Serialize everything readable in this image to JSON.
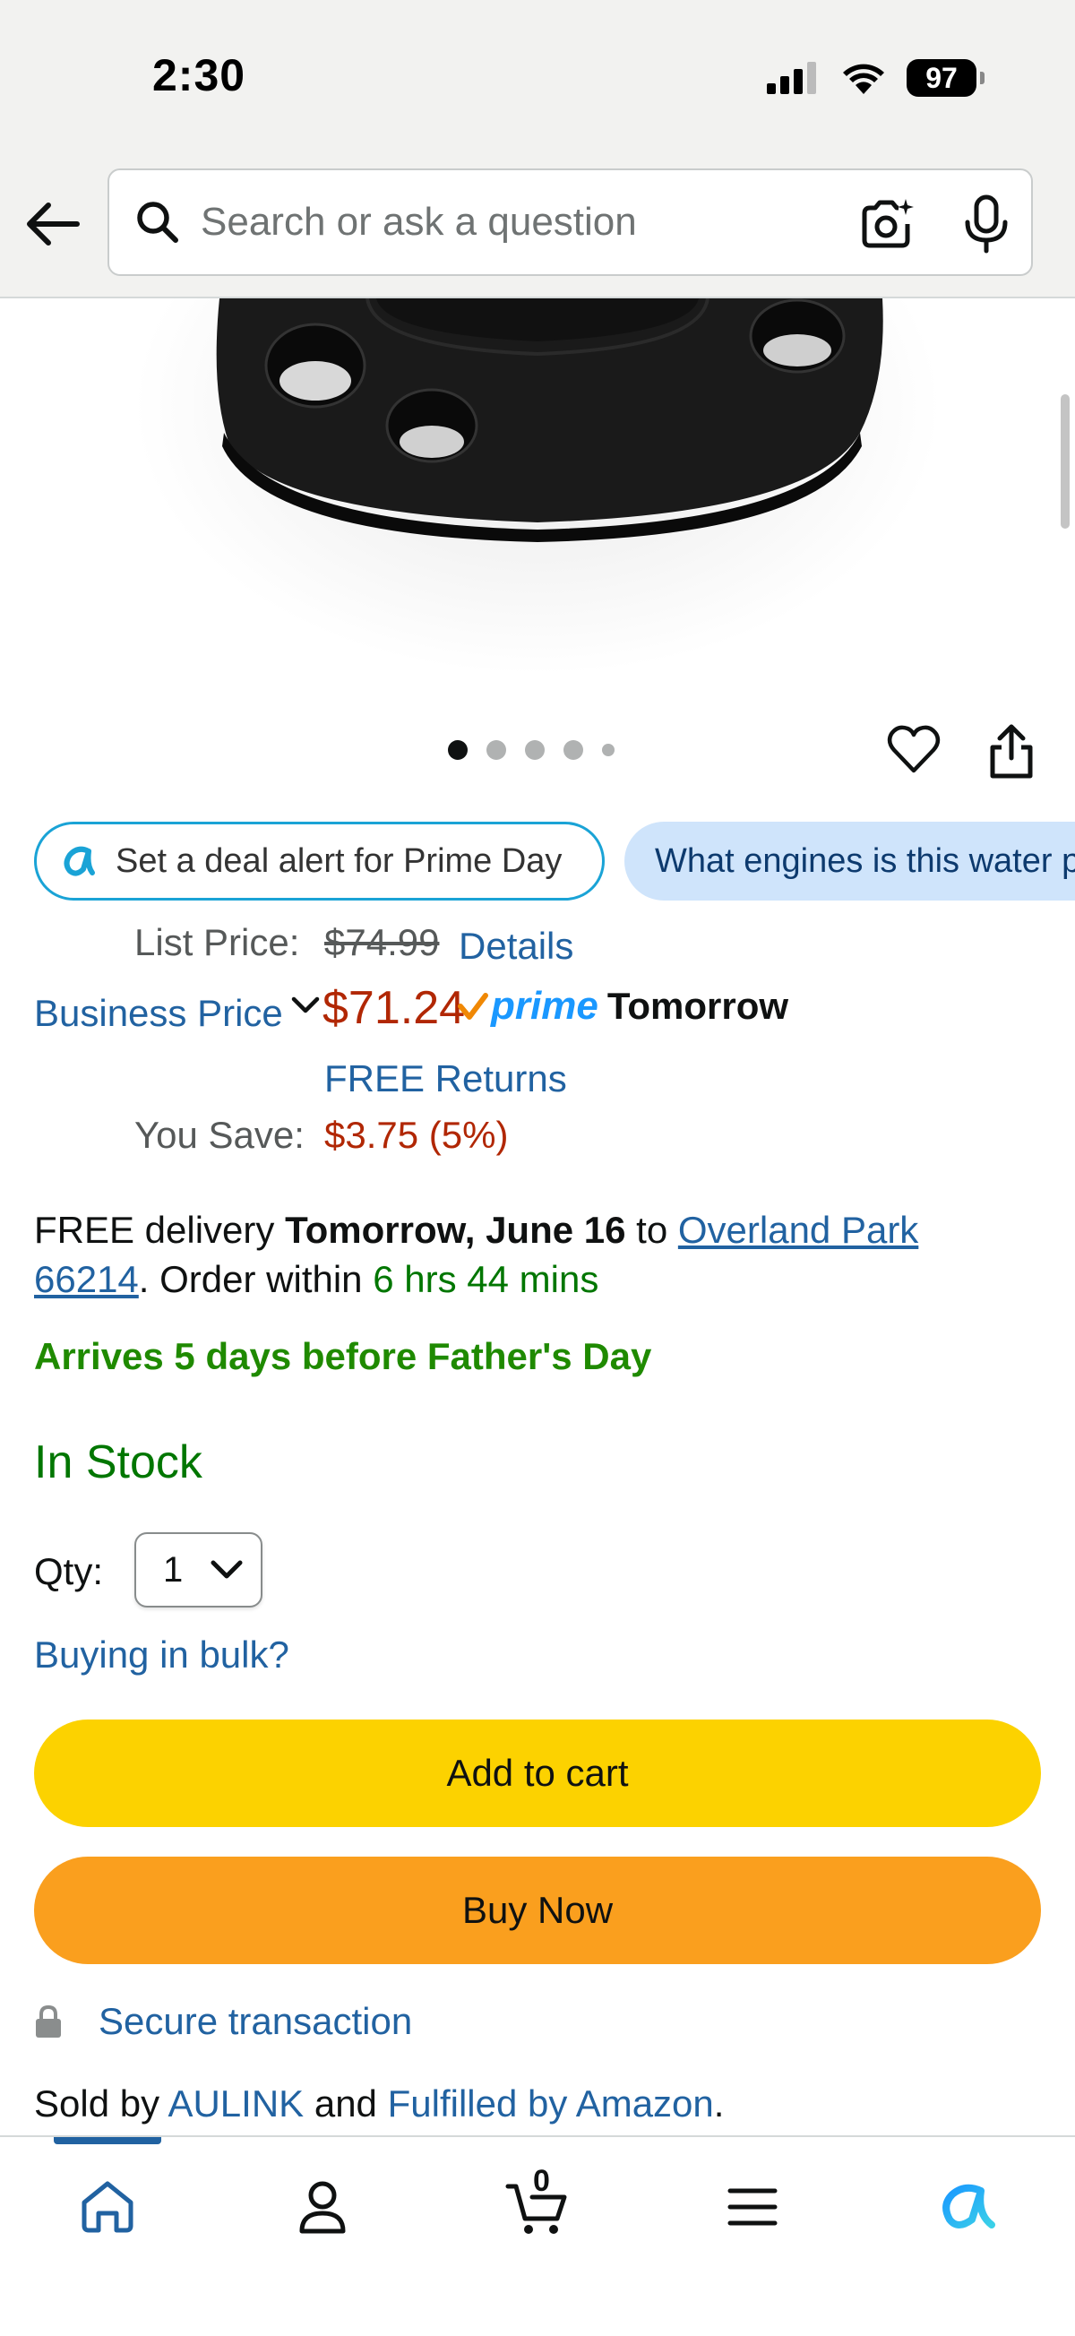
{
  "status_bar": {
    "time": "2:30",
    "battery": "97"
  },
  "search": {
    "placeholder": "Search or ask a question"
  },
  "chips": {
    "deal_alert": "Set a deal alert for Prime Day",
    "question": "What engines is this water pump compatible with?"
  },
  "pricing": {
    "list_price_label": "List Price:",
    "list_price": "$74.99",
    "details_link": "Details",
    "business_price_label": "Business Price",
    "price": "$71.24",
    "prime_label": "prime",
    "prime_delivery": "Tomorrow",
    "free_returns": "FREE Returns",
    "you_save_label": "You Save:",
    "you_save": "$3.75 (5%)"
  },
  "delivery": {
    "prefix": "FREE delivery ",
    "date": "Tomorrow, June 16",
    "to": " to ",
    "location": "Overland Park 66214",
    "order_within": ". Order within ",
    "countdown": "6 hrs 44 mins",
    "arrives_note": "Arrives 5 days before Father's Day"
  },
  "stock": {
    "status": "In Stock"
  },
  "quantity": {
    "label": "Qty:",
    "value": "1",
    "bulk_link": "Buying in bulk?"
  },
  "buttons": {
    "add_to_cart": "Add to cart",
    "buy_now": "Buy Now"
  },
  "secure": {
    "label": "Secure transaction"
  },
  "seller": {
    "prefix": "Sold by ",
    "seller_name": "AULINK",
    "middle": " and ",
    "fulfillment": "Fulfilled by Amazon",
    "suffix": "."
  },
  "carousel": {
    "total_dots": 5,
    "active_index": 0
  },
  "bottom_nav": {
    "items": [
      "home-icon",
      "account-icon",
      "cart-icon",
      "menu-icon",
      "rufus-icon"
    ],
    "cart_count": "0"
  },
  "colors": {
    "accent_link": "#2162a1",
    "price_red": "#b12704",
    "in_stock_green": "#007600",
    "add_to_cart": "#fcd200",
    "buy_now": "#fa9f1e",
    "prime_blue": "#1a98ff"
  }
}
